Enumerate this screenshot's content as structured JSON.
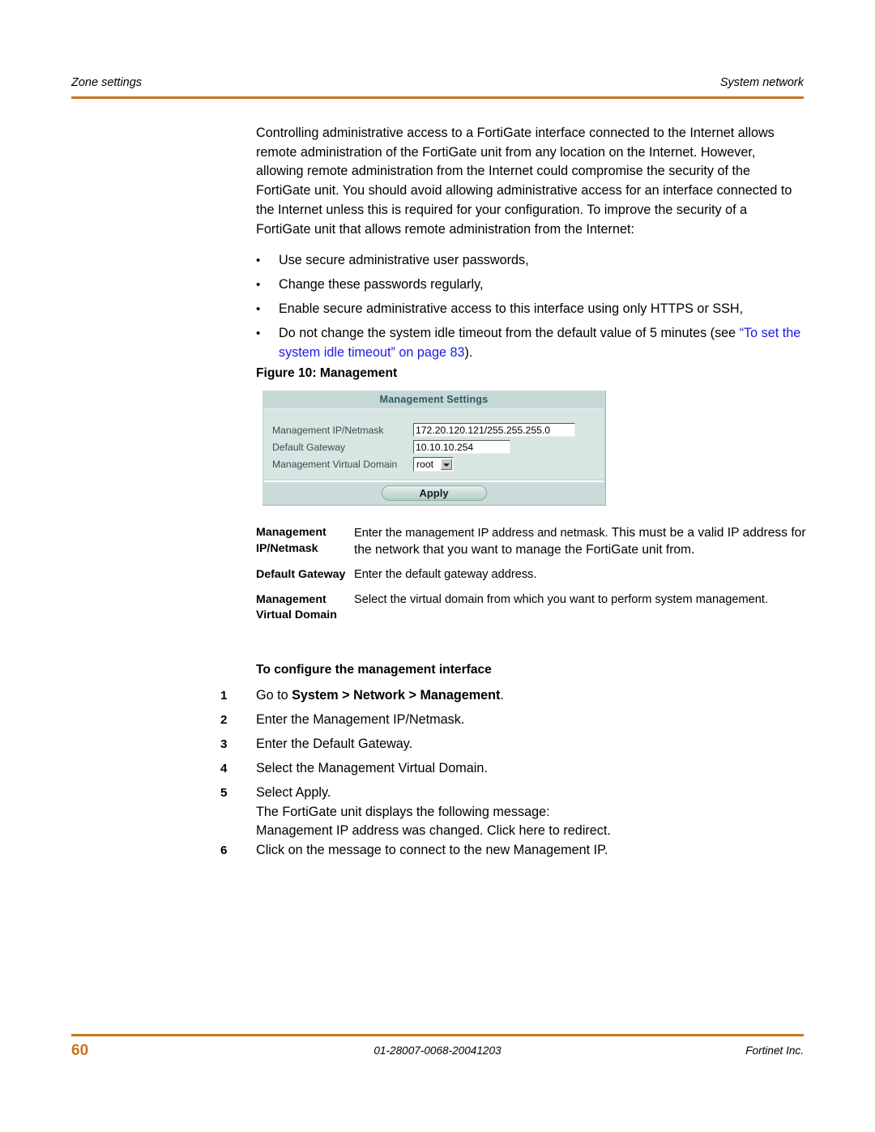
{
  "header": {
    "left": "Zone settings",
    "right": "System network",
    "rule_color": "#C8761C"
  },
  "intro_paragraph": "Controlling administrative access to a FortiGate interface connected to the Internet allows remote administration of the FortiGate unit from any location on the Internet. However, allowing remote administration from the Internet could compromise the security of the FortiGate unit. You should avoid allowing administrative access for an interface connected to the Internet unless this is required for your configuration. To improve the security of a FortiGate unit that allows remote administration from the Internet:",
  "bullets": [
    {
      "marker": "•",
      "text": "Use secure administrative user passwords,"
    },
    {
      "marker": "•",
      "text": "Change these passwords regularly,"
    },
    {
      "marker": "•",
      "text": "Enable secure administrative access to this interface using only HTTPS or SSH,"
    },
    {
      "marker": "•",
      "text_before": "Do not change the system idle timeout from the default value of 5 minutes (see ",
      "link_text": "“To set the system idle timeout” on page 83",
      "text_after": ").",
      "link_color": "#1A1AE6"
    }
  ],
  "figure": {
    "caption": "Figure 10: Management",
    "widget": {
      "title": "Management Settings",
      "fields": [
        {
          "label": "Management IP/Netmask",
          "value": "172.20.120.121/255.255.255.0",
          "type": "text"
        },
        {
          "label": "Default Gateway",
          "value": "10.10.10.254",
          "type": "text"
        },
        {
          "label": "Management Virtual Domain",
          "value": "root",
          "type": "select"
        }
      ],
      "apply_label": "Apply",
      "colors": {
        "frame": "#c9dcd9",
        "titlebar": "#c6d8d6",
        "title_text": "#2c5b5b",
        "body": "#d7e6e3",
        "label_text": "#3a4c4c"
      }
    }
  },
  "description_table": [
    {
      "term": "Management IP/Netmask",
      "definition_lead": "Enter the management IP address and netmask. ",
      "definition_emph": "This must be a valid IP address for the network that you want to manage the FortiGate unit from."
    },
    {
      "term": "Default Gateway",
      "definition_lead": "Enter the default gateway address.",
      "definition_emph": ""
    },
    {
      "term": "Management Virtual Domain",
      "definition_lead": "Select the virtual domain from which you want to perform system management.",
      "definition_emph": ""
    }
  ],
  "procedure": {
    "heading": "To configure the management interface",
    "steps": [
      {
        "num": "1",
        "text_before": "Go to ",
        "text_bold": "System > Network > Management",
        "text_after": "."
      },
      {
        "num": "2",
        "text_before": "Enter the Management IP/Netmask.",
        "text_bold": "",
        "text_after": ""
      },
      {
        "num": "3",
        "text_before": "Enter the Default Gateway.",
        "text_bold": "",
        "text_after": ""
      },
      {
        "num": "4",
        "text_before": "Select the Management Virtual Domain.",
        "text_bold": "",
        "text_after": ""
      },
      {
        "num": "5",
        "text_before": "Select Apply.",
        "text_bold": "",
        "text_after": "",
        "sub_lines": [
          "The FortiGate unit displays the following message:",
          "Management IP address was changed. Click here to redirect."
        ]
      },
      {
        "num": "6",
        "text_before": "Click on the message to connect to the new Management IP.",
        "text_bold": "",
        "text_after": ""
      }
    ]
  },
  "footer": {
    "page_number": "60",
    "doc_id": "01-28007-0068-20041203",
    "company": "Fortinet Inc.",
    "rule_color": "#C8761C",
    "page_number_color": "#C8761C"
  }
}
